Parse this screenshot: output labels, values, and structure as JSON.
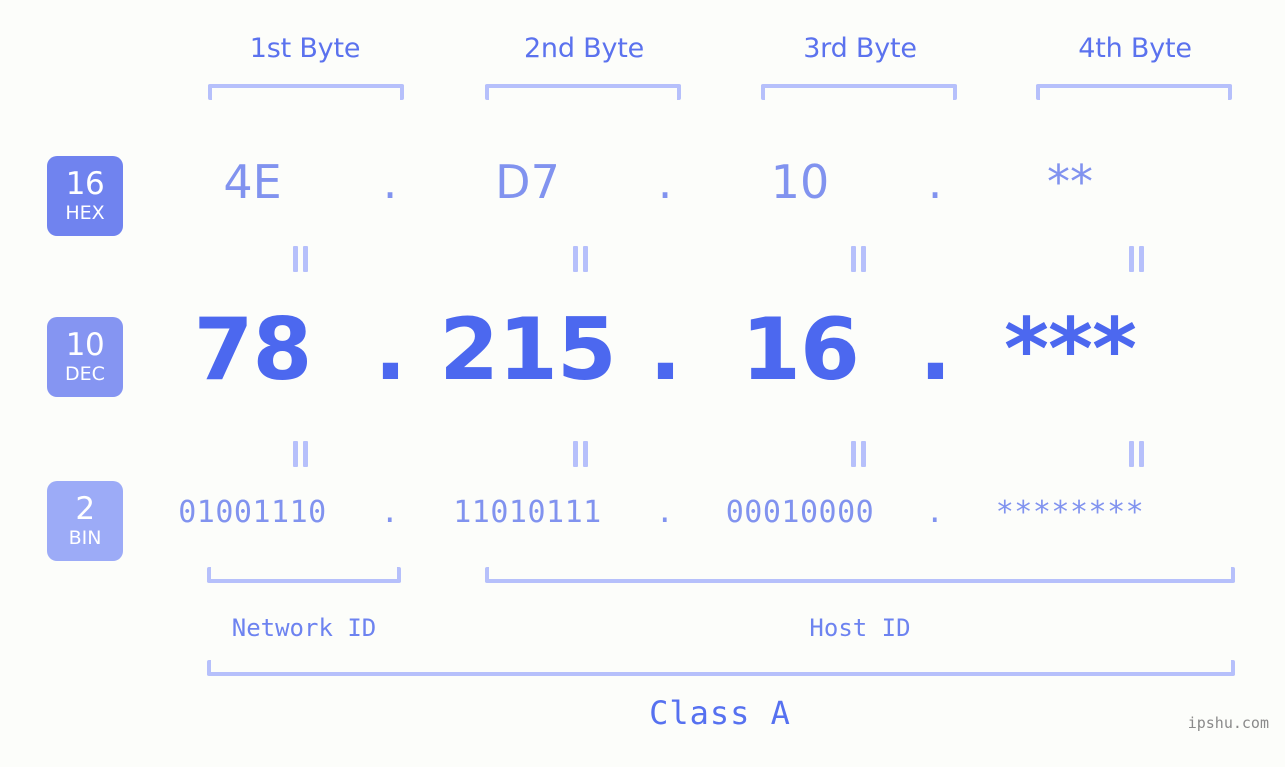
{
  "page": {
    "background_color": "#fcfdfa",
    "accent_color": "#5b72ee",
    "bracket_color": "#b6c0fb",
    "watermark": "ipshu.com"
  },
  "byte_headers": [
    {
      "label": "1st Byte"
    },
    {
      "label": "2nd Byte"
    },
    {
      "label": "3rd Byte"
    },
    {
      "label": "4th Byte"
    }
  ],
  "bases": [
    {
      "number": "16",
      "name": "HEX",
      "color": "#7083ef"
    },
    {
      "number": "10",
      "name": "DEC",
      "color": "#8595f2"
    },
    {
      "number": "2",
      "name": "BIN",
      "color": "#9cabf7"
    }
  ],
  "rows": {
    "hex": {
      "base_number": "16",
      "base_name": "HEX",
      "separator": ".",
      "values": [
        "4E",
        "D7",
        "10",
        "**"
      ]
    },
    "dec": {
      "base_number": "10",
      "base_name": "DEC",
      "separator": ".",
      "values": [
        "78",
        "215",
        "16",
        "***"
      ]
    },
    "bin": {
      "base_number": "2",
      "base_name": "BIN",
      "separator": ".",
      "values": [
        "01001110",
        "11010111",
        "00010000",
        "********"
      ]
    }
  },
  "connectors": {
    "glyph": "||",
    "meaning": "equals"
  },
  "segments": {
    "network_id": {
      "label": "Network ID"
    },
    "host_id": {
      "label": "Host ID"
    }
  },
  "class": {
    "label": "Class A"
  }
}
